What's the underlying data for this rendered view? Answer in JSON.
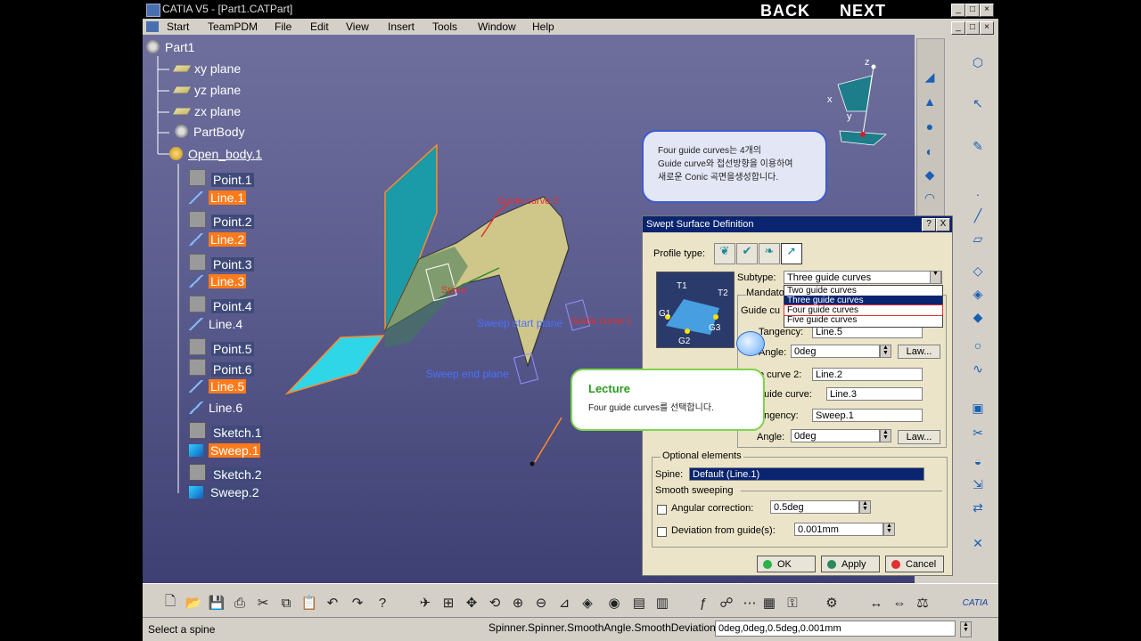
{
  "window": {
    "title": "CATIA V5 - [Part1.CATPart]",
    "back": "BACK",
    "next": "NEXT"
  },
  "menu": {
    "items": [
      "Start",
      "TeamPDM",
      "File",
      "Edit",
      "View",
      "Insert",
      "Tools",
      "Window",
      "Help"
    ]
  },
  "tree": {
    "root": "Part1",
    "nodes": [
      "xy plane",
      "yz plane",
      "zx plane",
      "PartBody",
      "Open_body.1",
      "Point.1",
      "Line.1",
      "Point.2",
      "Line.2",
      "Point.3",
      "Line.3",
      "Point.4",
      "Line.4",
      "Point.5",
      "Point.6",
      "Line.5",
      "Line.6",
      "Sketch.1",
      "Sweep.1",
      "Sketch.2",
      "Sweep.2"
    ]
  },
  "viewport_labels": {
    "guide_curve_2": "Guide curve 2",
    "guide_curve_1": "Guide curve 1",
    "sweep_start": "Sweep start plane",
    "sweep_end": "Sweep end plane",
    "spine": "Spine",
    "axis_x": "x",
    "axis_y": "y",
    "axis_z": "z"
  },
  "callout": {
    "line1": "Four guide curves는 4개의",
    "line2": "Guide curve와 접선방향을 이용하여",
    "line3": "새로운 Conic 곡면을생성합니다."
  },
  "lecture": {
    "title": "Lecture",
    "body": "Four guide curves를 선택합니다."
  },
  "dialog": {
    "title": "Swept Surface Definition",
    "help": "?",
    "close": "X",
    "profile_type_label": "Profile type:",
    "subtype_label": "Subtype:",
    "subtype_value": "Three guide curves",
    "subtype_options": [
      "Two guide curves",
      "Three guide curves",
      "Four guide curves",
      "Five guide curves"
    ],
    "preview_labels": [
      "T1",
      "T2",
      "G1",
      "G2",
      "G3"
    ],
    "mandatory_label": "Mandato",
    "guide_curve_label": "Guide cu",
    "tangency1_label": "Tangency:",
    "tangency1_value": "Line.5",
    "angle1_label": "Angle:",
    "angle1_value": "0deg",
    "law_label": "Law...",
    "guide_curve2_label": "e curve 2:",
    "guide_curve2_value": "Line.2",
    "last_guide_label": "guide curve:",
    "last_guide_value": "Line.3",
    "tangency2_label": "angency:",
    "tangency2_value": "Sweep.1",
    "angle2_label": "Angle:",
    "angle2_value": "0deg",
    "optional_label": "Optional elements",
    "spine_label": "Spine:",
    "spine_value": "Default (Line.1)",
    "smooth_label": "Smooth sweeping",
    "angular_label": "Angular correction:",
    "angular_value": "0.5deg",
    "deviation_label": "Deviation from guide(s):",
    "deviation_value": "0.001mm",
    "ok": "OK",
    "apply": "Apply",
    "cancel": "Cancel"
  },
  "status": {
    "left": "Select a spine",
    "right": "Spinner.Spinner.SmoothAngle.SmoothDeviation",
    "field": "0deg,0deg,0.5deg,0.001mm"
  },
  "colors": {
    "accent_orange": "#ff7a1a",
    "dialog_title": "#0a2470",
    "surface_cyan": "#2fd6e8",
    "surface_tan": "#cfc68a"
  }
}
